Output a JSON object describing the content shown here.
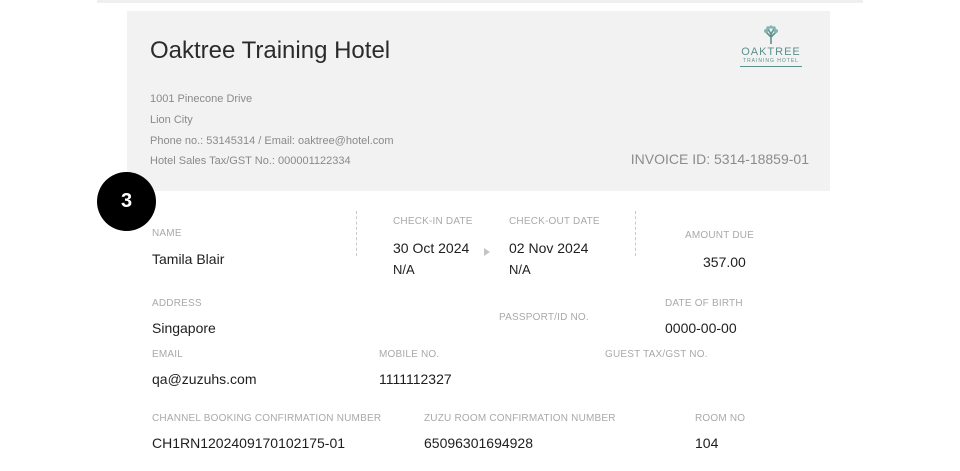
{
  "hotel": {
    "name": "Oaktree Training Hotel",
    "address_line1": "1001 Pinecone Drive",
    "address_line2": "Lion City",
    "contact": "Phone no.: 53145314 / Email: oaktree@hotel.com",
    "tax_no": "Hotel Sales Tax/GST No.: 000001122334",
    "invoice_id": "INVOICE ID: 5314-18859-01",
    "logo": {
      "name": "OAKTREE",
      "subtitle": "TRAINING HOTEL",
      "icon": "tree-icon",
      "color": "#5e8f8c"
    }
  },
  "step_badge": "3",
  "guest": {
    "name_label": "NAME",
    "name": "Tamila Blair",
    "checkin_label": "CHECK-IN DATE",
    "checkin_date": "30 Oct 2024",
    "checkin_time": "N/A",
    "checkout_label": "CHECK-OUT DATE",
    "checkout_date": "02 Nov 2024",
    "checkout_time": "N/A",
    "amount_label": "AMOUNT DUE",
    "amount": "357.00",
    "address_label": "ADDRESS",
    "address": "Singapore",
    "passport_label": "PASSPORT/ID NO.",
    "dob_label": "DATE OF BIRTH",
    "dob": "0000-00-00",
    "email_label": "EMAIL",
    "email": "qa@zuzuhs.com",
    "mobile_label": "MOBILE NO.",
    "mobile": "1111112327",
    "guest_tax_label": "GUEST TAX/GST NO.",
    "channel_label": "CHANNEL BOOKING CONFIRMATION NUMBER",
    "channel_no": "CH1RN1202409170102175-01",
    "zuzu_label": "ZUZU ROOM CONFIRMATION NUMBER",
    "zuzu_no": "65096301694928",
    "room_label": "ROOM NO",
    "room_no": "104"
  }
}
